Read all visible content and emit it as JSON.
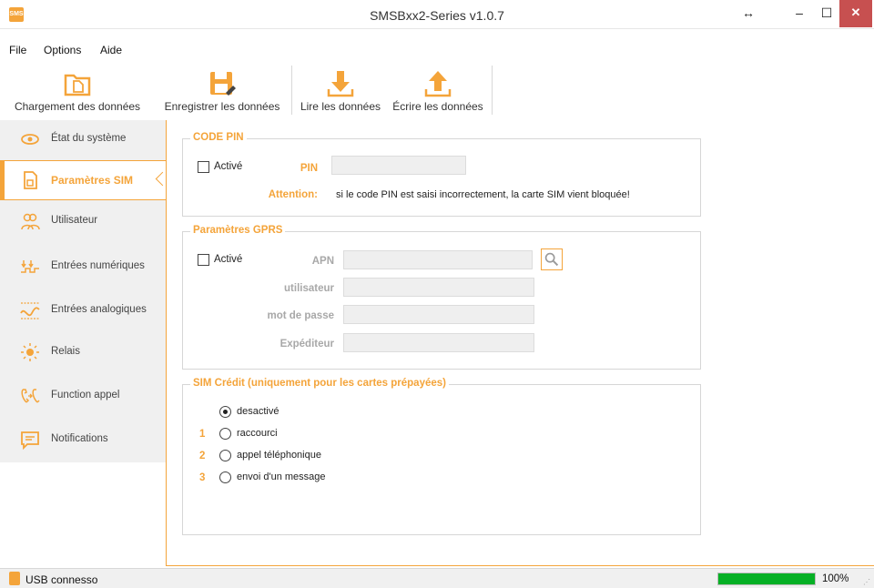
{
  "window": {
    "title": "SMSBxx2-Series v1.0.7",
    "app_icon_text": "SMS",
    "resize_glyph": "↔",
    "min_glyph": "–",
    "max_glyph": "☐",
    "close_glyph": "✕"
  },
  "menu": [
    "File",
    "Options",
    "Aide"
  ],
  "toolbar": [
    {
      "label": "Chargement des données",
      "icon": "folder-open-icon"
    },
    {
      "label": "Enregistrer les données",
      "icon": "save-icon"
    },
    {
      "label": "Lire les données",
      "icon": "download-arrow-icon"
    },
    {
      "label": "Écrire les données",
      "icon": "upload-arrow-icon"
    }
  ],
  "sidebar": {
    "items": [
      {
        "label": "État du système",
        "icon": "eye-icon"
      },
      {
        "label": "Paramètres SIM",
        "icon": "sim-card-icon",
        "active": true
      },
      {
        "label": "Utilisateur",
        "icon": "users-icon"
      },
      {
        "label": "Entrées numériques",
        "icon": "digital-input-icon"
      },
      {
        "label": "Entrées analogiques",
        "icon": "analog-input-icon"
      },
      {
        "label": "Relais",
        "icon": "relay-bulb-icon"
      },
      {
        "label": "Function appel",
        "icon": "phone-call-icon"
      },
      {
        "label": "Notifications",
        "icon": "message-icon"
      }
    ]
  },
  "pin": {
    "title": "CODE PIN",
    "enabled_label": "Activé",
    "pin_label": "PIN",
    "pin_value": "",
    "attention_label": "Attention:",
    "attention_text": "si le code PIN est saisi incorrectement, la carte SIM vient bloquée!"
  },
  "gprs": {
    "title": "Paramètres GPRS",
    "enabled_label": "Activé",
    "apn_label": "APN",
    "user_label": "utilisateur",
    "password_label": "mot de passe",
    "sender_label": "Expéditeur",
    "apn_value": "",
    "user_value": "",
    "password_value": "",
    "sender_value": ""
  },
  "credit": {
    "title": "SIM Crédit (uniquement pour les cartes prépayées)",
    "options": [
      {
        "num": "",
        "label": "desactivé",
        "checked": true
      },
      {
        "num": "1",
        "label": "raccourci",
        "checked": false
      },
      {
        "num": "2",
        "label": "appel téléphonique",
        "checked": false
      },
      {
        "num": "3",
        "label": "envoi d'un message",
        "checked": false
      }
    ]
  },
  "status": {
    "text": "USB connesso",
    "progress": 100,
    "progress_text": "100%",
    "grip": "⋰"
  },
  "colors": {
    "accent": "#f4a43a",
    "progress": "#06b025",
    "close": "#c75050"
  }
}
